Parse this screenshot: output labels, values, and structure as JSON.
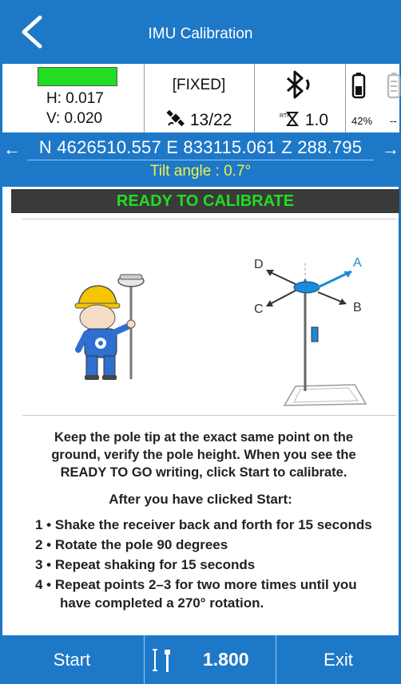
{
  "header": {
    "title": "IMU Calibration"
  },
  "status": {
    "h": "H: 0.017",
    "v": "V: 0.020",
    "solution": "[FIXED]",
    "satellites": "13/22",
    "rtk_value": "1.0",
    "battery_pct": "42%",
    "battery2": "--",
    "quality_color": "#22dd22"
  },
  "position": {
    "coordinates": "N 4626510.557 E 833115.061 Z 288.795",
    "tilt": "Tilt angle : 0.7°"
  },
  "banner": {
    "text": "READY TO CALIBRATE"
  },
  "diagram": {
    "labels": {
      "a": "A",
      "b": "B",
      "c": "C",
      "d": "D"
    }
  },
  "instructions": {
    "line1": "Keep the pole tip at the exact same point on the",
    "line2": "ground, verify the pole height. When you see the",
    "line3": "READY TO GO writing, click Start to calibrate.",
    "after": "After you have clicked Start:",
    "steps": [
      "1 • Shake the receiver back and forth for 15 seconds",
      "2 • Rotate the pole 90 degrees",
      "3 • Repeat shaking for 15 seconds",
      "4 • Repeat points 2–3 for two more times until you"
    ],
    "step4_cont": "have completed a 270° rotation."
  },
  "bottom": {
    "start": "Start",
    "pole_height": "1.800",
    "exit": "Exit"
  },
  "colors": {
    "primary": "#1e78c8",
    "ready_green": "#22dd22",
    "tilt_yellow": "#f0f04a"
  }
}
